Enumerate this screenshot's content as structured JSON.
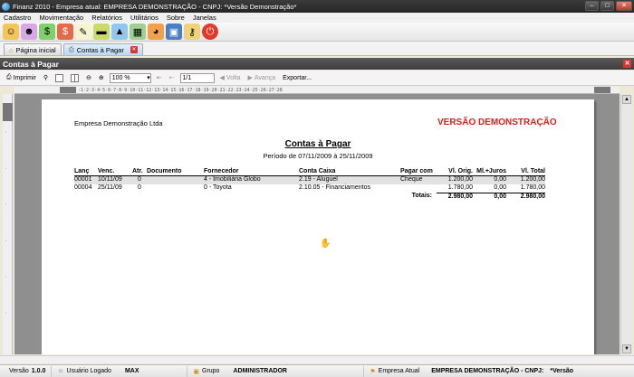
{
  "window": {
    "title": "Finanz 2010 - Empresa atual: EMPRESA DEMONSTRAÇÃO - CNPJ:  *Versão Demonstração*"
  },
  "menu": [
    "Cadastro",
    "Movimentação",
    "Relatórios",
    "Utilitários",
    "Sobre",
    "Janelas"
  ],
  "toolbar_icons": [
    "people-icon",
    "users-icon",
    "money-bag-icon",
    "money-icon",
    "notepad-icon",
    "banknote-icon",
    "chart-icon",
    "calculator-icon",
    "pie-chart-icon",
    "save-icon",
    "keys-icon",
    "power-icon"
  ],
  "tabs": [
    {
      "label": "Página inicial",
      "active": false
    },
    {
      "label": "Contas à Pagar",
      "active": true
    }
  ],
  "panel": {
    "title": "Contas à Pagar"
  },
  "report_toolbar": {
    "print_label": "Imprimir",
    "zoom": "100 %",
    "page": "1/1",
    "back_label": "Volta",
    "forward_label": "Avança",
    "export_label": "Exportar..."
  },
  "ruler": {
    "marks": "·1·2·3·4·5·6·7·8·9·10·11·12·13·14·15·16·17·18·19·20·21·22·23·24·25·26·27·28"
  },
  "report": {
    "company": "Empresa Demonstração Ltda",
    "watermark": "VERSÃO DEMONSTRAÇÃO",
    "title": "Contas à Pagar",
    "period": "Período de 07/11/2009 à 25/11/2009",
    "columns": [
      "Lanç",
      "Venc.",
      "Atr.",
      "Documento",
      "Fornecedor",
      "Conta Caixa",
      "Pagar com",
      "Vl. Orig.",
      "Ml.+Juros",
      "Vl. Total"
    ],
    "rows": [
      [
        "00001",
        "10/11/09",
        "0",
        "",
        "4 - Imobiliária Globo",
        "2.19 - Aluguel",
        "Cheque",
        "1.200,00",
        "0,00",
        "1.200,00"
      ],
      [
        "00004",
        "25/11/09",
        "0",
        "",
        "0 - Toyota",
        "2.10.05 - Financiamentos",
        "",
        "1.780,00",
        "0,00",
        "1.780,00"
      ]
    ],
    "totals": {
      "label": "Totais:",
      "orig": "2.980,00",
      "juros": "0,00",
      "total": "2.980,00"
    }
  },
  "status": {
    "version_label": "Versão",
    "version": "1.0.0",
    "user_label": "Usuário Logado",
    "user": "MAX",
    "group_label": "Grupo",
    "group": "ADMINISTRADOR",
    "company_label": "Empresa Atual",
    "company": "EMPRESA DEMONSTRAÇÃO - CNPJ:",
    "demo": "*Versão"
  }
}
